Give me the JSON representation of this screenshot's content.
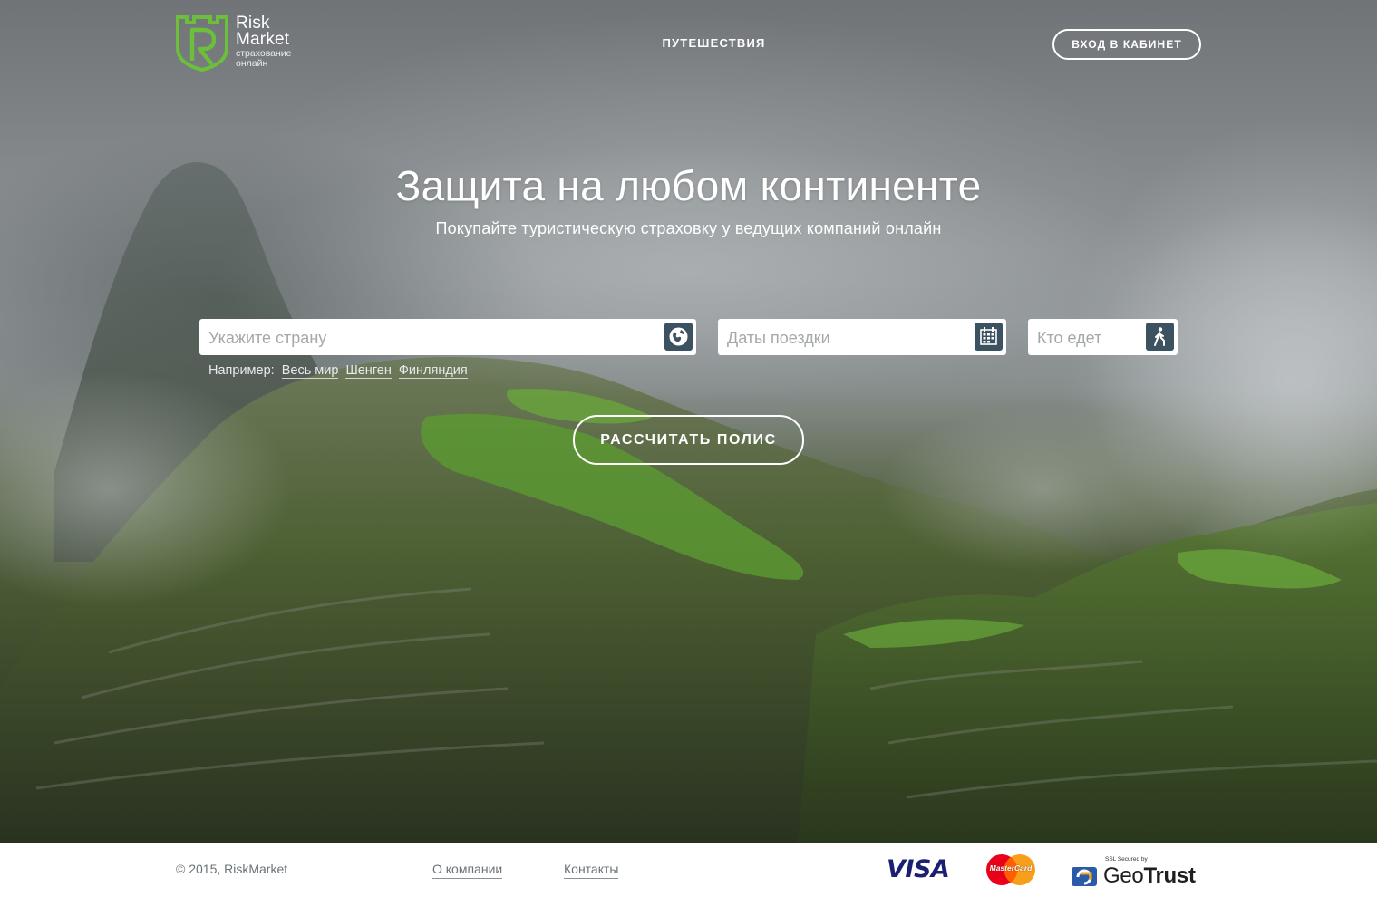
{
  "header": {
    "logo": {
      "name_line1": "Risk",
      "name_line2": "Market",
      "tagline_line1": "страхование",
      "tagline_line2": "онлайн"
    },
    "nav_travel": "ПУТЕШЕСТВИЯ",
    "login_button": "ВХОД В КАБИНЕТ"
  },
  "hero": {
    "headline": "Защита на любом континенте",
    "subline": "Покупайте туристическую страховку у ведущих компаний онлайн"
  },
  "search": {
    "country": {
      "placeholder": "Укажите страну",
      "icon": "globe-icon"
    },
    "dates": {
      "placeholder": "Даты поездки",
      "icon": "calendar-icon"
    },
    "travelers": {
      "placeholder": "Кто едет",
      "icon": "walking-person-icon"
    },
    "examples_label": "Например:",
    "examples": [
      "Весь мир",
      "Шенген",
      "Финляндия"
    ],
    "calculate_button": "РАССЧИТАТЬ ПОЛИС"
  },
  "footer": {
    "copyright": "© 2015, RiskMarket",
    "links": [
      "О компании",
      "Контакты"
    ],
    "payment": {
      "visa": "VISA",
      "mastercard": "MasterCard"
    },
    "ssl": {
      "secured_by": "SSL Secured by",
      "brand_light": "Geo",
      "brand_bold": "Trust"
    }
  },
  "colors": {
    "brand_green": "#6cbf3a",
    "icon_bg": "#3c5260",
    "visa_blue": "#1a1f71",
    "mastercard_red": "#eb001b",
    "mastercard_orange": "#f79e1b",
    "geotrust_blue": "#2b5aa8"
  }
}
